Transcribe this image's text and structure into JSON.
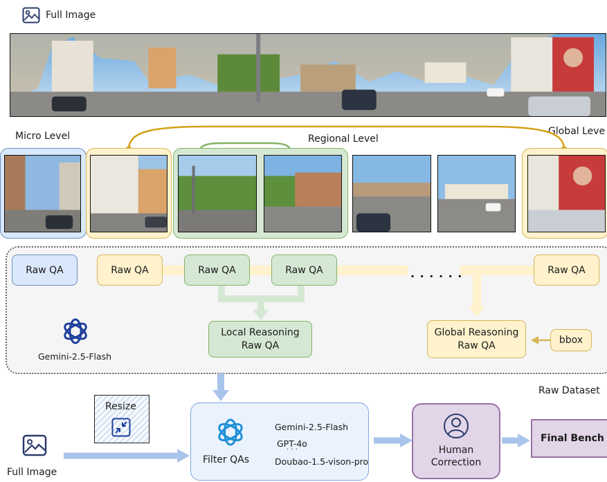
{
  "header": {
    "full_image_label": "Full Image",
    "icon": "image-icon"
  },
  "levels": {
    "micro": "Micro Level",
    "regional": "Regional Level",
    "global": "Global Leve"
  },
  "raw_qa": {
    "label": "Raw QA",
    "dots": "· · · · · ·"
  },
  "reasoning": {
    "local": "Local Reasoning\nRaw QA",
    "global": "Global Reasoning\nRaw QA",
    "bbox": "bbox"
  },
  "gemini": {
    "label": "Gemini-2.5-Flash",
    "icon": "openai-logo-icon"
  },
  "raw_dataset": "Raw Dataset",
  "bottom": {
    "full_image_label": "Full Image",
    "resize_label": "Resize",
    "resize_icon": "shrink-arrows-icon",
    "filter_label": "Filter QAs",
    "models": [
      "Gemini-2.5-Flash",
      "GPT-4o",
      "· · ·",
      "Doubao-1.5-vison-pro"
    ],
    "human_correction": "Human\nCorrection",
    "human_icon": "person-icon",
    "final_bench": "Final Bench"
  },
  "colors": {
    "yellow_fill": "#fff2cc",
    "yellow_stroke": "#d6b656",
    "green_fill": "#d5e8d4",
    "green_stroke": "#82b366",
    "blue_fill": "#dae8fc",
    "blue_stroke": "#6c8ebf",
    "purple_fill": "#e1d5e7",
    "purple_stroke": "#9673a6",
    "global_arc": "#d4a017",
    "arrow_blue": "#a9c4eb"
  }
}
